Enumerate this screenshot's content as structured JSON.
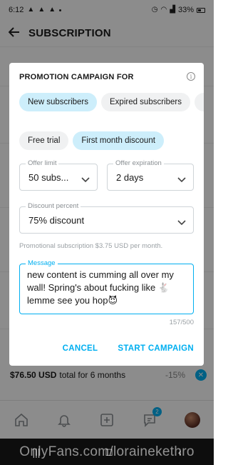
{
  "status_bar": {
    "time": "6:12",
    "battery": "33%"
  },
  "header": {
    "title": "SUBSCRIPTION"
  },
  "price_row": {
    "amount": "$76.50 USD",
    "description": "total for 6 months",
    "percent": "-15%"
  },
  "bottom_nav": {
    "messages_badge": "2"
  },
  "dialog": {
    "title": "PROMOTION CAMPAIGN FOR",
    "audience_chips": [
      {
        "label": "New subscribers",
        "selected": true
      },
      {
        "label": "Expired subscribers",
        "selected": false
      }
    ],
    "type_chips": [
      {
        "label": "Free trial",
        "selected": false
      },
      {
        "label": "First month discount",
        "selected": true
      }
    ],
    "offer_limit": {
      "label": "Offer limit",
      "value": "50 subs..."
    },
    "offer_expiration": {
      "label": "Offer expiration",
      "value": "2 days"
    },
    "discount_percent": {
      "label": "Discount percent",
      "value": "75% discount"
    },
    "promo_note": "Promotional subscription $3.75 USD per month.",
    "message": {
      "label": "Message",
      "value": "new content is cumming all over my wall! Spring's about fucking like 🐇 lemme see you hop😈"
    },
    "counter": "157/500",
    "cancel_label": "CANCEL",
    "start_label": "START CAMPAIGN"
  },
  "watermark": "OnlyFans.com/lorainekethro",
  "colors": {
    "accent": "#00aff0",
    "chip_selected": "#cdeefb",
    "chip_default": "#f0f1f2"
  }
}
